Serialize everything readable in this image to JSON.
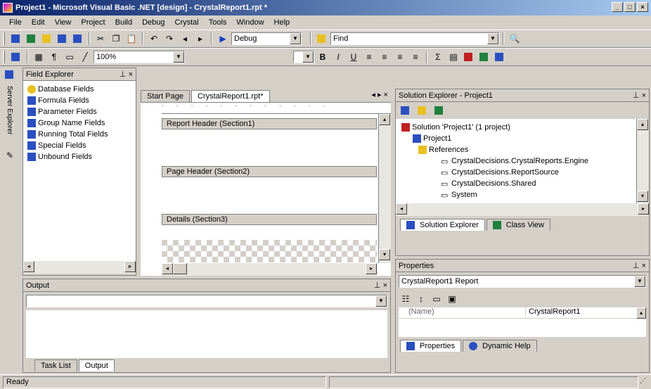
{
  "window": {
    "title": "Project1 - Microsoft Visual Basic .NET [design] - CrystalReport1.rpt *",
    "buttons": [
      "_",
      "□",
      "×"
    ]
  },
  "menu": [
    "File",
    "Edit",
    "View",
    "Project",
    "Build",
    "Debug",
    "Crystal",
    "Tools",
    "Window",
    "Help"
  ],
  "toolbar1": {
    "config_value": "Debug",
    "find_value": "Find"
  },
  "toolbar2": {
    "zoom_value": "100%"
  },
  "field_explorer": {
    "title": "Field Explorer",
    "items": [
      {
        "label": "Database Fields",
        "icon": "database-icon"
      },
      {
        "label": "Formula Fields",
        "icon": "formula-icon"
      },
      {
        "label": "Parameter Fields",
        "icon": "parameter-icon"
      },
      {
        "label": "Group Name Fields",
        "icon": "group-icon"
      },
      {
        "label": "Running Total Fields",
        "icon": "running-total-icon"
      },
      {
        "label": "Special Fields",
        "icon": "special-icon"
      },
      {
        "label": "Unbound Fields",
        "icon": "unbound-icon"
      }
    ]
  },
  "side_strip": {
    "label": "Server Explorer"
  },
  "editor": {
    "tabs": [
      "Start Page",
      "CrystalReport1.rpt*"
    ],
    "sections": [
      "Report Header (Section1)",
      "Page Header (Section2)",
      "Details (Section3)"
    ]
  },
  "output": {
    "title": "Output",
    "tabs": [
      "Task List",
      "Output"
    ]
  },
  "solution_explorer": {
    "title": "Solution Explorer - Project1",
    "tree": [
      {
        "label": "Solution 'Project1' (1 project)",
        "indent": 0
      },
      {
        "label": "Project1",
        "indent": 1
      },
      {
        "label": "References",
        "indent": 2
      },
      {
        "label": "CrystalDecisions.CrystalReports.Engine",
        "indent": 3
      },
      {
        "label": "CrystalDecisions.ReportSource",
        "indent": 3
      },
      {
        "label": "CrystalDecisions.Shared",
        "indent": 3
      },
      {
        "label": "System",
        "indent": 3
      }
    ],
    "tabs": [
      "Solution Explorer",
      "Class View"
    ]
  },
  "properties": {
    "title": "Properties",
    "object": "CrystalReport1 Report",
    "rows": [
      {
        "name": "(Name)",
        "value": "CrystalReport1"
      }
    ],
    "tabs": [
      "Properties",
      "Dynamic Help"
    ]
  },
  "status": {
    "text": "Ready"
  }
}
